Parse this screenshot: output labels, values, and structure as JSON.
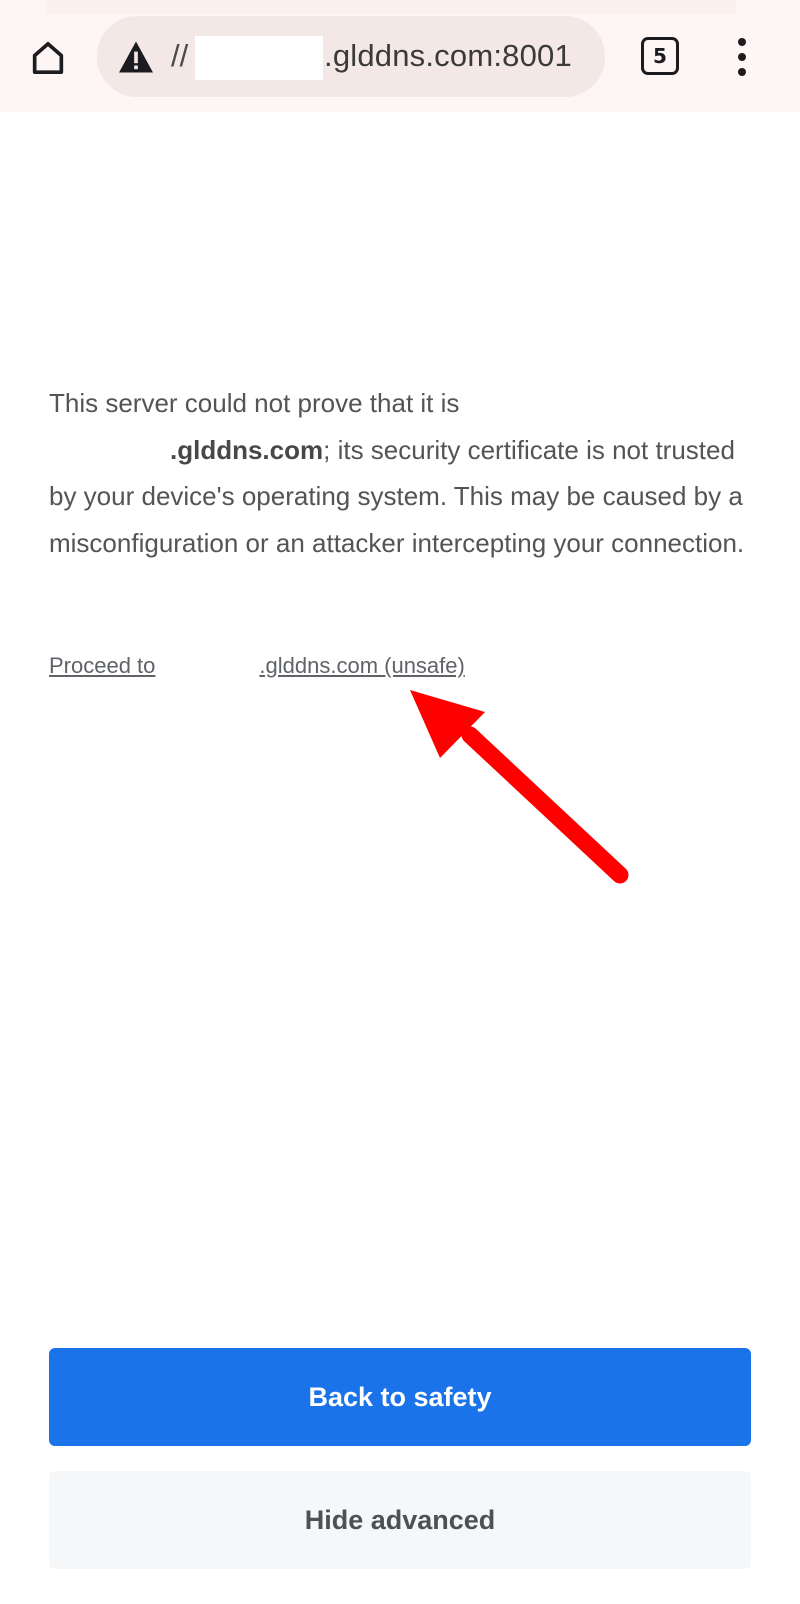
{
  "browser": {
    "url_prefix": "//",
    "url_host": ".glddns.com:8001",
    "tab_count": "5",
    "icons": {
      "home": "home-icon",
      "security": "warning-triangle-icon",
      "tabs": "tab-switcher-icon",
      "menu": "more-vert-icon"
    }
  },
  "interstitial": {
    "message_start": "This server could not prove that it is",
    "domain_bold": ".glddns.com",
    "message_end": "; its security certificate is not trusted by your device's operating system. This may be caused by a misconfiguration or an attacker intercepting your connection.",
    "proceed_prefix": "Proceed to",
    "proceed_suffix": ".glddns.com (unsafe)"
  },
  "actions": {
    "back_to_safety": "Back to safety",
    "hide_advanced": "Hide advanced"
  },
  "colors": {
    "primary_button": "#1a73e8",
    "secondary_button": "#f6f7f9",
    "annotation_arrow": "#ff0000",
    "body_text": "#545457"
  }
}
